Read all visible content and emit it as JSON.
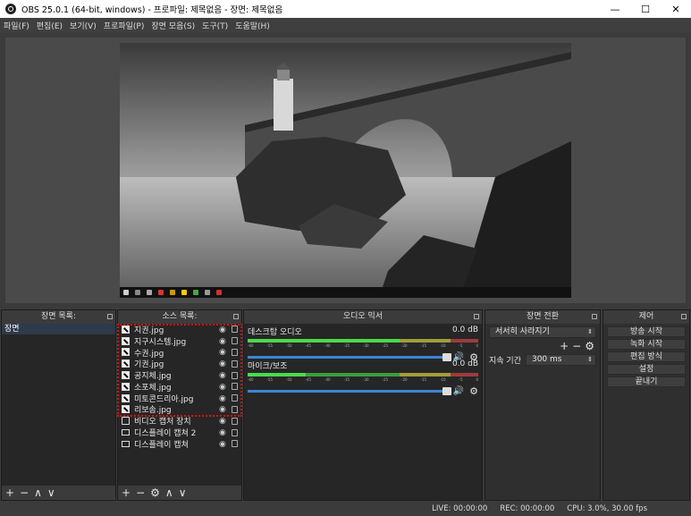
{
  "window": {
    "title": "OBS 25.0.1 (64-bit, windows) - 프로파일: 제목없음 - 장면: 제목없음"
  },
  "menu": [
    "파일(F)",
    "편집(E)",
    "보기(V)",
    "프로파일(P)",
    "장면 모음(S)",
    "도구(T)",
    "도움말(H)"
  ],
  "docks": {
    "scenes": {
      "title": "장면 목록:",
      "items": [
        "장면"
      ],
      "footer": [
        "+",
        "−",
        "∧",
        "∨"
      ]
    },
    "sources": {
      "title": "소스 목록:",
      "items": [
        {
          "label": "지권.jpg",
          "icon": "image-icon"
        },
        {
          "label": "지구시스템.jpg",
          "icon": "image-icon"
        },
        {
          "label": "수권.jpg",
          "icon": "image-icon"
        },
        {
          "label": "기권.jpg",
          "icon": "image-icon"
        },
        {
          "label": "공지체.jpg",
          "icon": "image-icon"
        },
        {
          "label": "소포체.jpg",
          "icon": "image-icon"
        },
        {
          "label": "미토콘드리아.jpg",
          "icon": "image-icon"
        },
        {
          "label": "리보솜.jpg",
          "icon": "image-icon"
        },
        {
          "label": "비디오 캡처 장치",
          "icon": "camera-icon"
        },
        {
          "label": "디스플레이 캡쳐 2",
          "icon": "monitor-icon"
        },
        {
          "label": "디스플레이 캡쳐",
          "icon": "monitor-icon"
        }
      ],
      "footer": [
        "+",
        "−",
        "⚙",
        "∧",
        "∨"
      ]
    },
    "mixer": {
      "title": "오디오 믹서",
      "channels": [
        {
          "name": "데스크탑 오디오",
          "db": "0.0 dB"
        },
        {
          "name": "마이크/보조",
          "db": "0.0 dB"
        }
      ]
    },
    "transitions": {
      "title": "장면 전환",
      "selected": "서서히 사라지기",
      "duration_label": "지속 기간",
      "duration_value": "300 ms"
    },
    "controls": {
      "title": "제어",
      "buttons": [
        "방송 시작",
        "녹화 시작",
        "편집 방식",
        "설정",
        "끝내기"
      ]
    }
  },
  "status": {
    "live": "LIVE: 00:00:00",
    "rec": "REC: 00:00:00",
    "cpu": "CPU: 3.0%, 30.00 fps"
  },
  "colors": {
    "panel": "#2f2f2f",
    "selection": "#2d3a4a",
    "meter_green": "#4cd94c",
    "fader_blue": "#3a86d4",
    "highlight_red": "#dd1111"
  }
}
